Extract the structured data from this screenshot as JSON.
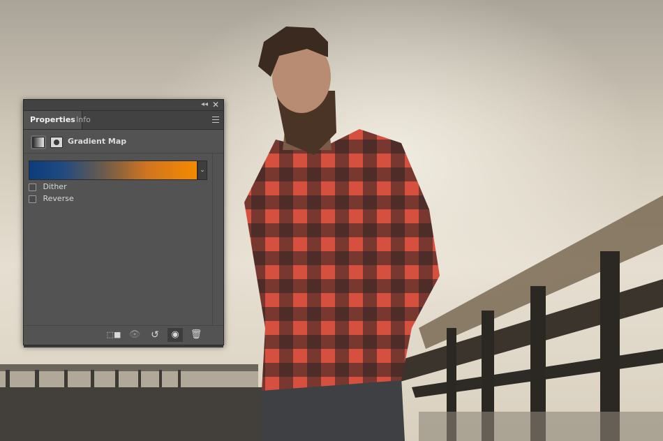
{
  "panel": {
    "tabs": [
      {
        "label": "Properties",
        "active": true
      },
      {
        "label": "Info",
        "active": false
      }
    ],
    "adjustment_title": "Gradient Map",
    "gradient": {
      "start_color": "#0c3c7c",
      "end_color": "#f48a00"
    },
    "options": [
      {
        "label": "Dither",
        "checked": false
      },
      {
        "label": "Reverse",
        "checked": false
      }
    ],
    "footer_buttons": [
      "clip-to-layer-icon",
      "view-previous-state-icon",
      "reset-icon",
      "visibility-eye-icon",
      "trash-icon"
    ]
  },
  "colors": {
    "panel_bg": "#535353",
    "panel_header": "#424242",
    "text": "#d6d6d6"
  }
}
